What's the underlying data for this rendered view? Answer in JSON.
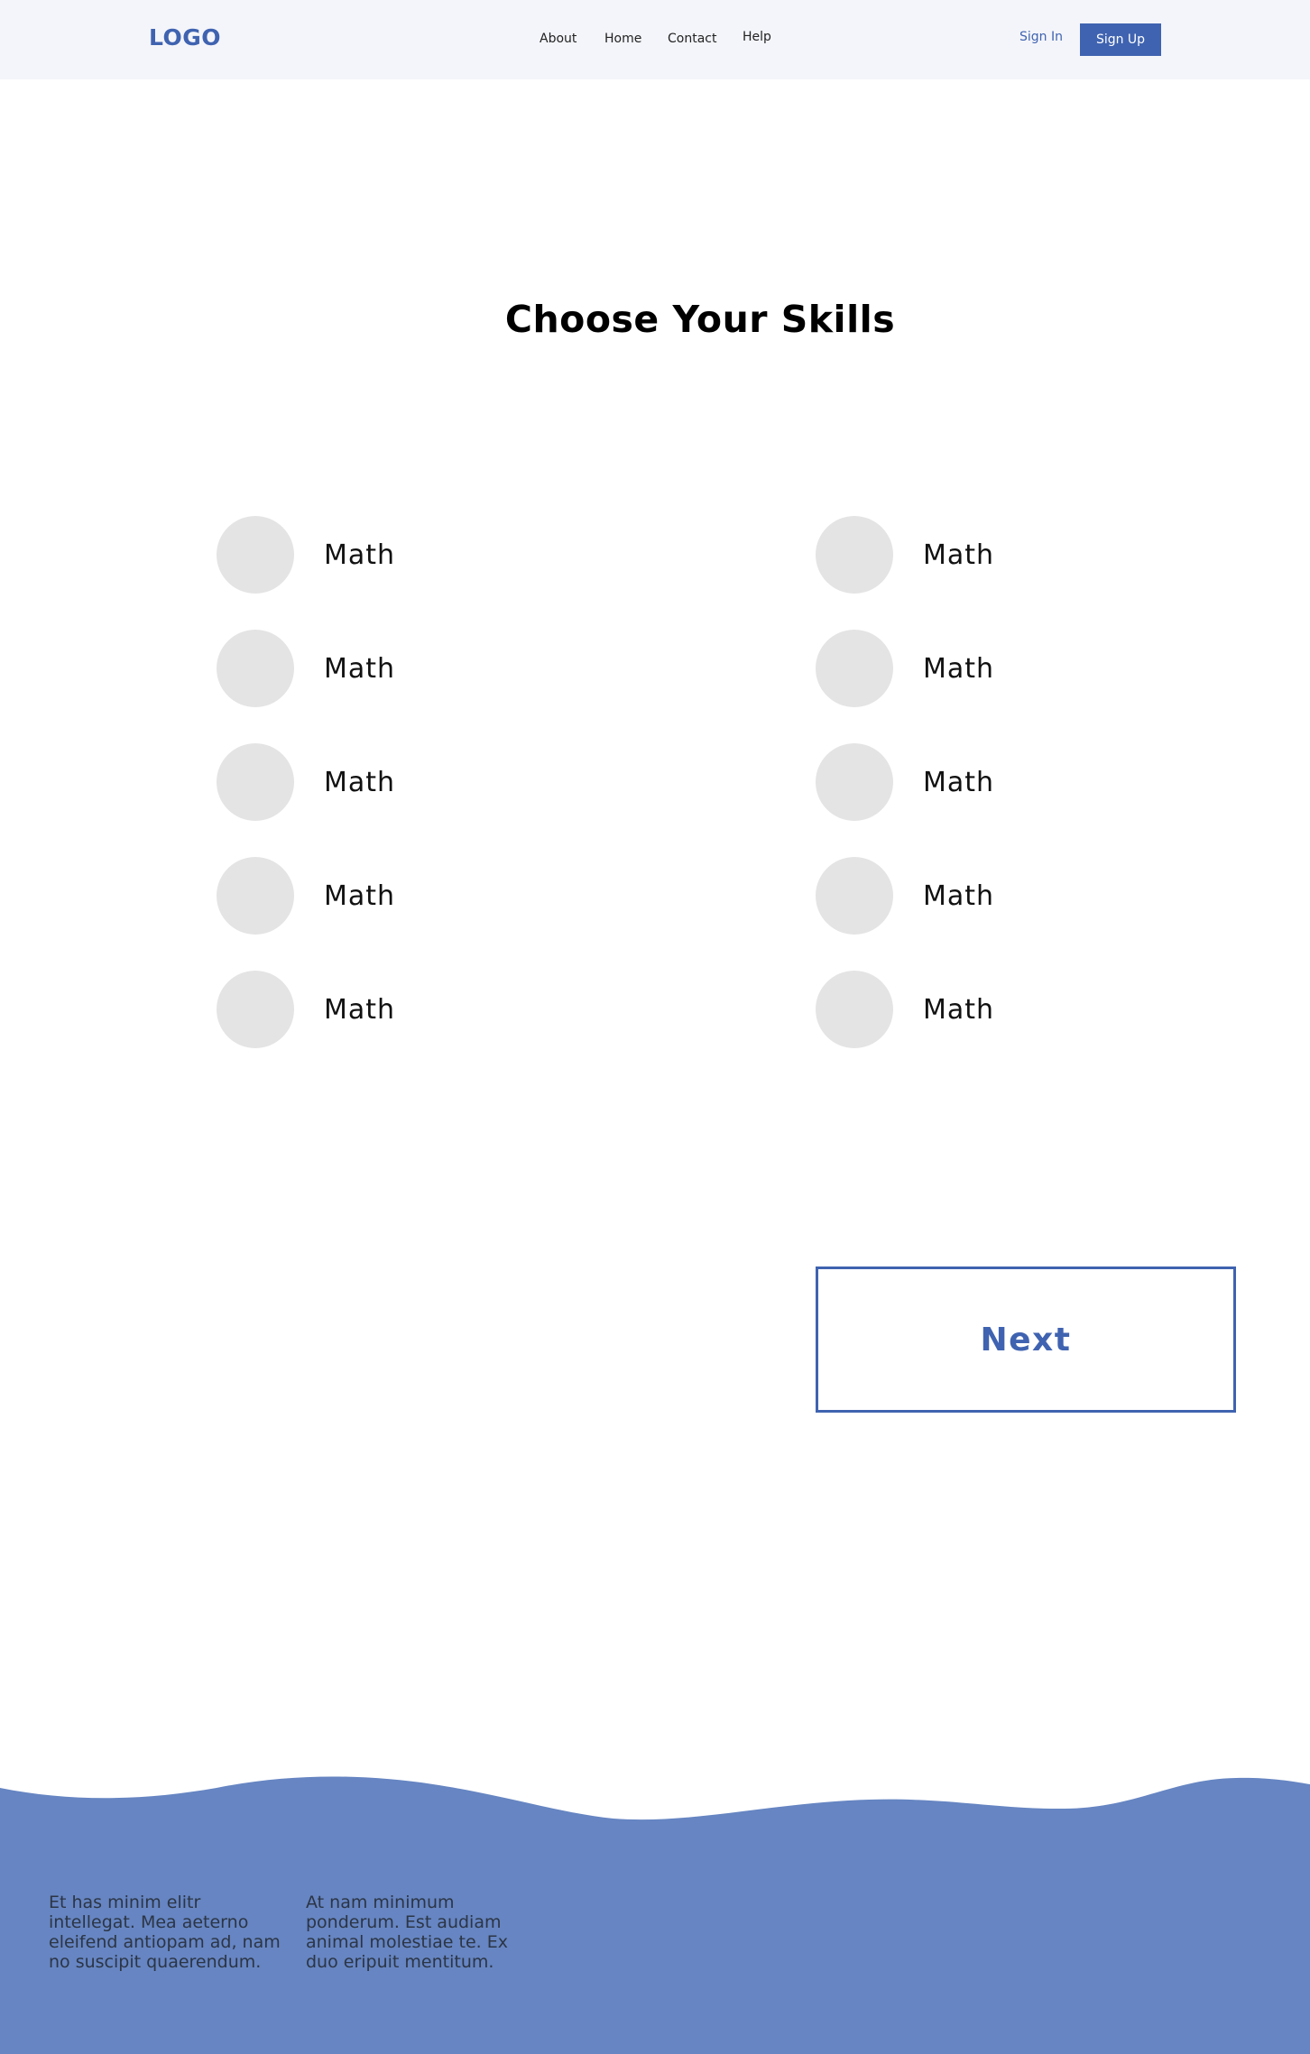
{
  "header": {
    "logo": "LOGO",
    "nav": [
      "About",
      "Home",
      "Contact",
      "Help"
    ],
    "sign_in": "Sign In",
    "sign_up": "Sign Up"
  },
  "main": {
    "title": "Choose Your Skills",
    "skills_left": [
      "Math",
      "Math",
      "Math",
      "Math",
      "Math"
    ],
    "skills_right": [
      "Math",
      "Math",
      "Math",
      "Math",
      "Math"
    ],
    "next_label": "Next"
  },
  "footer": {
    "col1": "Et has minim elitr intellegat. Mea aeterno eleifend antiopam ad, nam no suscipit quaerendum.",
    "col2": "At nam minimum ponderum. Est audiam animal molestiae te. Ex duo eripuit mentitum."
  },
  "colors": {
    "accent": "#3f63b0",
    "footer": "#6685c2",
    "header_bg": "#f4f5fa",
    "skill_circle": "#e4e4e4"
  }
}
